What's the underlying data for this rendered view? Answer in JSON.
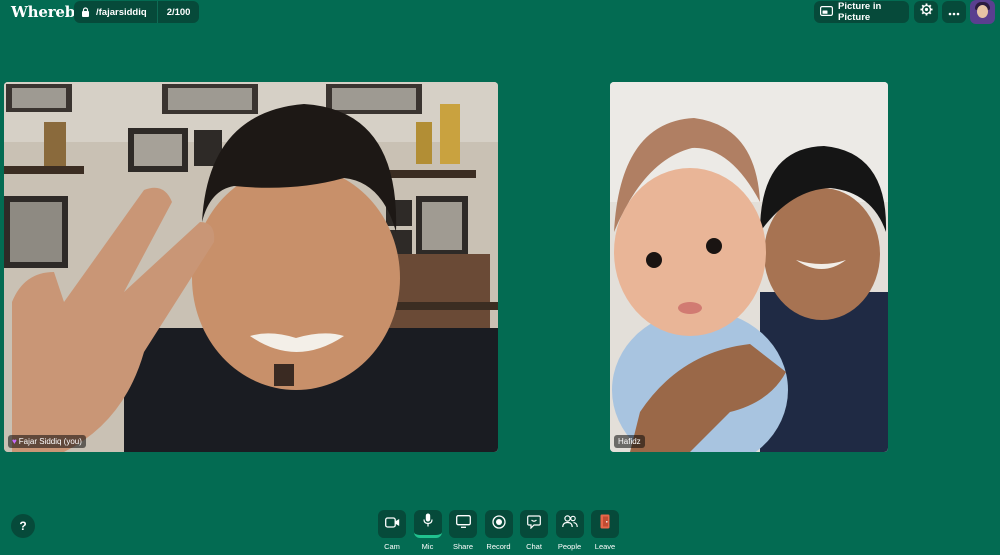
{
  "app": {
    "logo": "Whereby"
  },
  "room": {
    "name": "/fajarsiddiq",
    "count": "2/100"
  },
  "header": {
    "pip_label": "Picture in Picture"
  },
  "participants": [
    {
      "name": "Fajar Siddiq (you)"
    },
    {
      "name": "Hafidz"
    }
  ],
  "help": {
    "label": "?"
  },
  "toolbar": {
    "cam": "Cam",
    "mic": "Mic",
    "share": "Share",
    "record": "Record",
    "chat": "Chat",
    "people": "People",
    "leave": "Leave"
  },
  "colors": {
    "background": "#036b52",
    "button": "#064a3a",
    "mic_active": "#21c28f",
    "leave": "#e8674a"
  }
}
